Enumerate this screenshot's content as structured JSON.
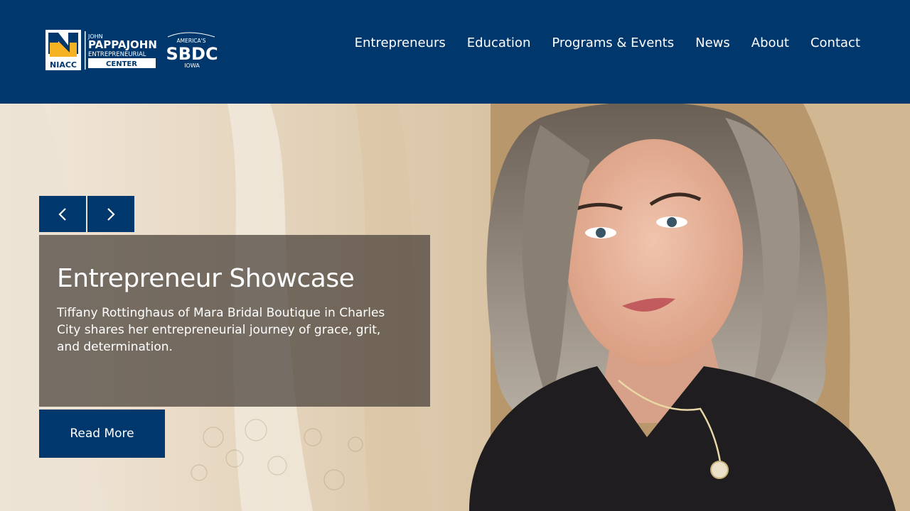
{
  "header": {
    "logo": {
      "niacc_letters": "NIACC",
      "line1": "JOHN",
      "line2": "PAPPAJOHN",
      "line3": "ENTREPRENEURIAL",
      "line4": "CENTER",
      "sbdc_top": "AMERICA'S",
      "sbdc_main": "SBDC",
      "sbdc_bottom": "IOWA"
    },
    "nav": [
      {
        "label": "Entrepreneurs"
      },
      {
        "label": "Education"
      },
      {
        "label": "Programs & Events"
      },
      {
        "label": "News"
      },
      {
        "label": "About"
      },
      {
        "label": "Contact"
      }
    ]
  },
  "slider": {
    "prev_icon": "chevron-left-icon",
    "next_icon": "chevron-right-icon",
    "title": "Entrepreneur Showcase",
    "description": "Tiffany Rottinghaus of Mara Bridal Boutique in Charles City shares her entrepreneurial journey of grace, grit, and determination.",
    "button_label": "Read More"
  },
  "colors": {
    "header_bg": "#00386e",
    "button_bg": "#00386e",
    "logo_gold": "#f5b324",
    "caption_overlay": "rgba(70,62,55,0.72)"
  }
}
